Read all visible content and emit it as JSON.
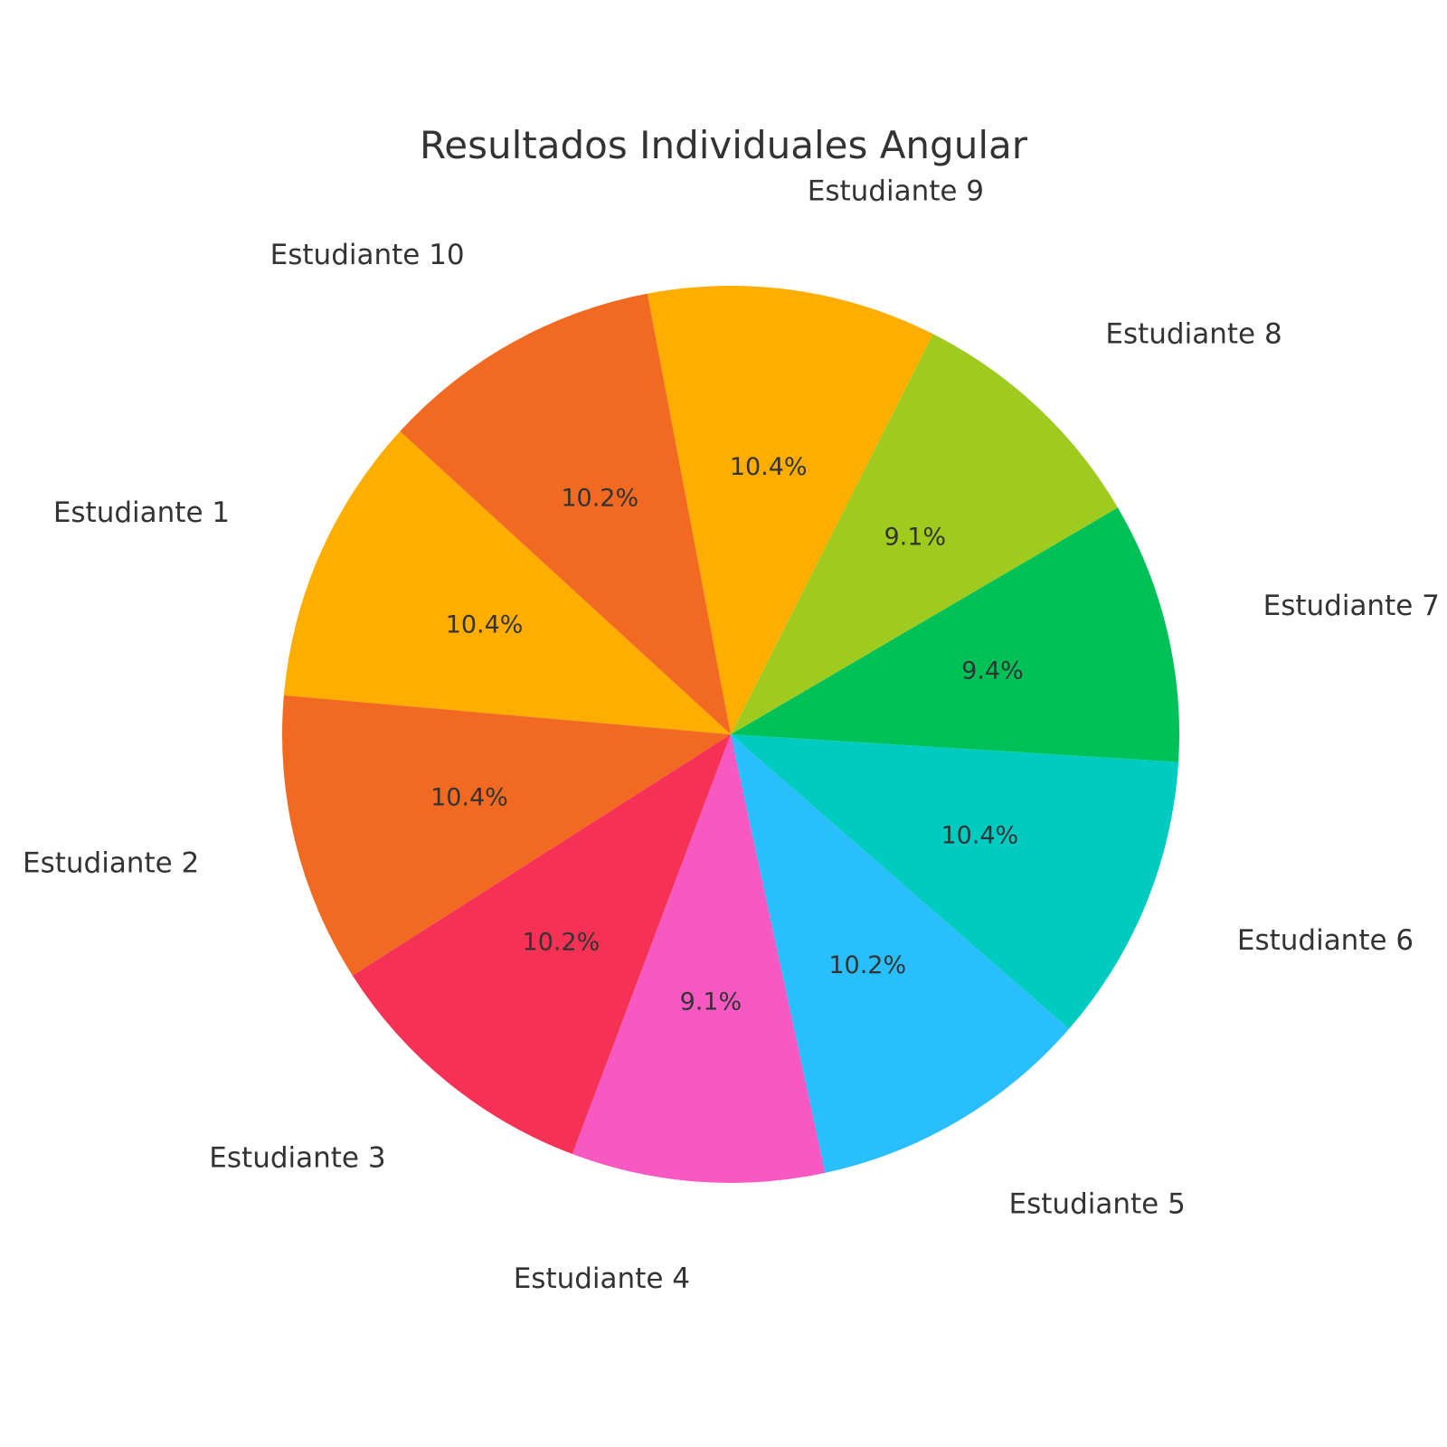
{
  "chart_data": {
    "type": "pie",
    "title": "Resultados Individuales Angular",
    "categories": [
      "Estudiante 1",
      "Estudiante 2",
      "Estudiante 3",
      "Estudiante 4",
      "Estudiante 5",
      "Estudiante 6",
      "Estudiante 7",
      "Estudiante 8",
      "Estudiante 9",
      "Estudiante 10"
    ],
    "values": [
      10.4,
      10.4,
      10.2,
      9.1,
      10.2,
      10.4,
      9.4,
      9.1,
      10.4,
      10.2
    ],
    "value_labels": [
      "10.4%",
      "10.4%",
      "10.2%",
      "9.1%",
      "10.2%",
      "10.4%",
      "9.4%",
      "9.1%",
      "10.4%",
      "10.2%"
    ],
    "colors": [
      "#FFAE00",
      "#F26A22",
      "#F53256",
      "#F758C1",
      "#29BEFD",
      "#00CBC0",
      "#00C058",
      "#9ECB1D",
      "#FFAE00",
      "#F26A22"
    ],
    "start_angle_deg": 137.5,
    "direction": "counterclockwise",
    "legend": "none"
  }
}
